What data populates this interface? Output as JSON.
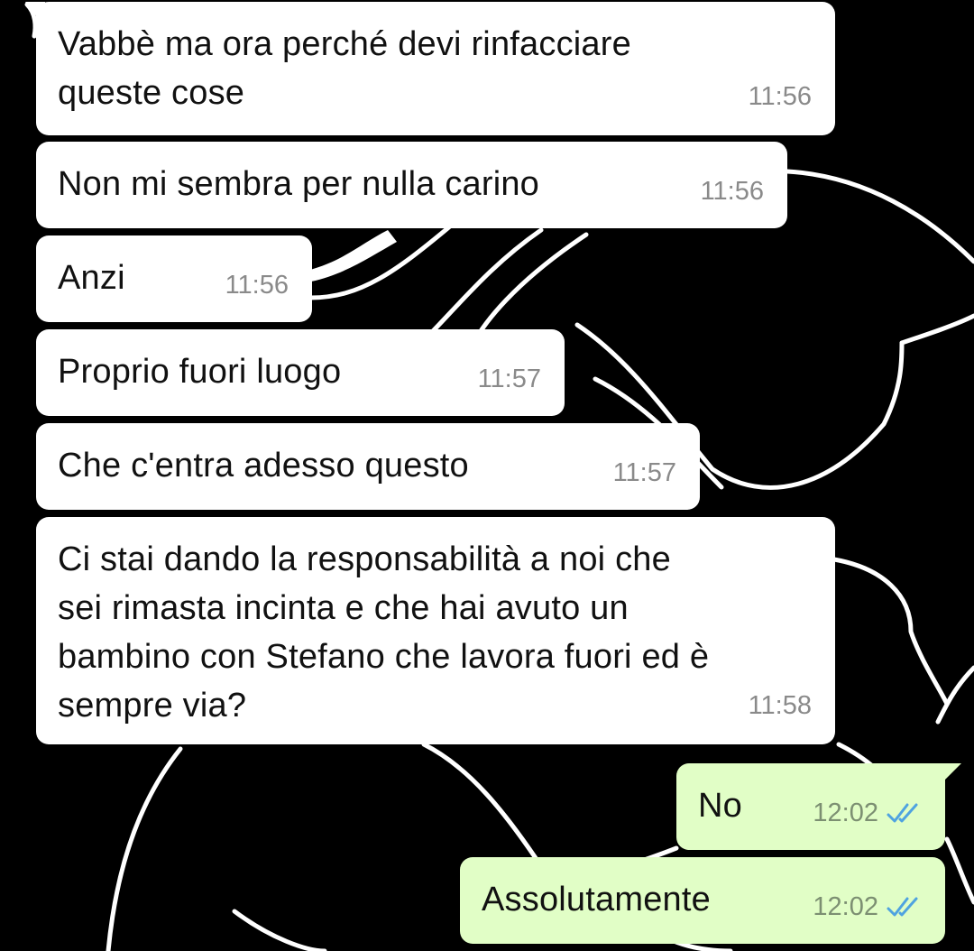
{
  "colors": {
    "background": "#000000",
    "incoming_bubble": "#ffffff",
    "outgoing_bubble": "#e1fec6",
    "timestamp": "#8a8a8a",
    "read_ticks": "#4fa3e0"
  },
  "messages": [
    {
      "direction": "in",
      "text": "Vabbè ma ora perché devi rinfacciare\nqueste cose",
      "time": "11:56"
    },
    {
      "direction": "in",
      "text": "Non mi sembra per nulla carino",
      "time": "11:56"
    },
    {
      "direction": "in",
      "text": "Anzi",
      "time": "11:56"
    },
    {
      "direction": "in",
      "text": "Proprio fuori luogo",
      "time": "11:57"
    },
    {
      "direction": "in",
      "text": "Che c'entra adesso questo",
      "time": "11:57"
    },
    {
      "direction": "in",
      "text": "Ci stai dando la responsabilità a noi che\nsei rimasta incinta e che hai avuto un\nbambino con Stefano che lavora fuori ed è\nsempre via?",
      "time": "11:58"
    },
    {
      "direction": "out",
      "text": "No",
      "time": "12:02",
      "status_icon": "double-check-read-icon"
    },
    {
      "direction": "out",
      "text": "Assolutamente",
      "time": "12:02",
      "status_icon": "double-check-read-icon"
    }
  ]
}
